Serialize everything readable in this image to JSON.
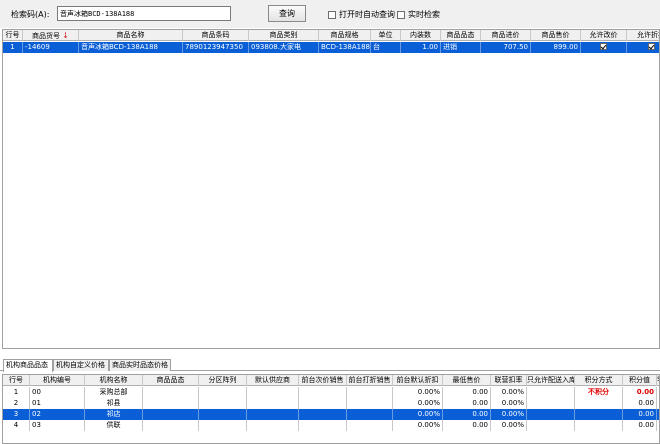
{
  "search": {
    "label": "检索码(A):",
    "value": "音声冰箱BCD-138A188",
    "button": "查询",
    "auto_query_label": "打开时自动查询",
    "realtime_label": "实时检索"
  },
  "product_grid": {
    "headers": [
      "行号",
      "商品货号",
      "商品名称",
      "商品条码",
      "商品类别",
      "商品规格",
      "单位",
      "内装数",
      "商品品态",
      "商品进价",
      "商品售价",
      "允许改价",
      "允许折扣"
    ],
    "rows": [
      {
        "row_no": "1",
        "code": "-14609",
        "name": "音声冰箱BCD-138A188",
        "barcode": "7890123947350",
        "category": "093808.大家电",
        "spec": "BCD-138A188",
        "unit": "台",
        "pack_qty": "1.00",
        "state": "进销",
        "purchase_price": "707.50",
        "sale_price": "899.00",
        "allow_price_change": true,
        "allow_discount": true
      }
    ]
  },
  "tabs": [
    {
      "label": "机构商品品态",
      "active": true
    },
    {
      "label": "机构自定义价格",
      "active": false
    },
    {
      "label": "商品实时品态价格",
      "active": false
    }
  ],
  "org_grid": {
    "headers": [
      "行号",
      "机构编号",
      "机构名称",
      "商品品态",
      "分区阵列",
      "默认供应商",
      "前台次价销售",
      "前台打折销售",
      "前台默认折扣",
      "最低售价",
      "联营扣率",
      "只允许配送入库",
      "积分方式",
      "积分值",
      "零"
    ],
    "rows": [
      {
        "row_no": "1",
        "org_code": "00",
        "org_name": "采购总部",
        "discount": "0.00%",
        "min_price": "0.00",
        "rate": "0.00%",
        "points_mode": "不积分",
        "points": "0.00",
        "selected": false
      },
      {
        "row_no": "2",
        "org_code": "01",
        "org_name": "祁县",
        "discount": "0.00%",
        "min_price": "0.00",
        "rate": "0.00%",
        "points_mode": "",
        "points": "0.00",
        "selected": false
      },
      {
        "row_no": "3",
        "org_code": "02",
        "org_name": "祁店",
        "discount": "0.00%",
        "min_price": "0.00",
        "rate": "0.00%",
        "points_mode": "",
        "points": "0.00",
        "selected": true
      },
      {
        "row_no": "4",
        "org_code": "03",
        "org_name": "供联",
        "discount": "0.00%",
        "min_price": "0.00",
        "rate": "0.00%",
        "points_mode": "",
        "points": "0.00",
        "selected": false
      }
    ]
  },
  "colors": {
    "selection": "#0a5fd6",
    "highlight_text": "#e00000",
    "sort_arrow": "#d02020"
  }
}
